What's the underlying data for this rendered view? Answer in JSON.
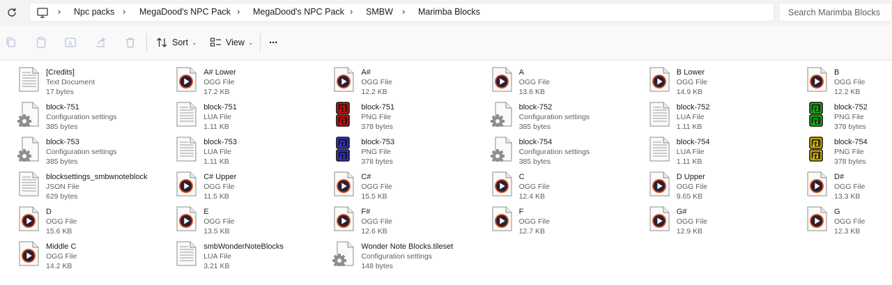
{
  "breadcrumb": [
    "Npc packs",
    "MegaDood's NPC Pack",
    "MegaDood's NPC Pack",
    "SMBW",
    "Marimba Blocks"
  ],
  "search": {
    "placeholder": "Search Marimba Blocks"
  },
  "toolbar": {
    "sort_label": "Sort",
    "view_label": "View",
    "more_label": "···"
  },
  "files": [
    {
      "name": "[Credits]",
      "type": "Text Document",
      "size": "17 bytes",
      "icon": "text-file-icon"
    },
    {
      "name": "A# Lower",
      "type": "OGG File",
      "size": "17.2 KB",
      "icon": "audio-file-icon"
    },
    {
      "name": "A#",
      "type": "OGG File",
      "size": "12.2 KB",
      "icon": "audio-file-icon"
    },
    {
      "name": "A",
      "type": "OGG File",
      "size": "13.6 KB",
      "icon": "audio-file-icon"
    },
    {
      "name": "B Lower",
      "type": "OGG File",
      "size": "14.9 KB",
      "icon": "audio-file-icon"
    },
    {
      "name": "B",
      "type": "OGG File",
      "size": "12.2 KB",
      "icon": "audio-file-icon"
    },
    {
      "name": "block-751",
      "type": "Configuration settings",
      "size": "385 bytes",
      "icon": "config-file-icon"
    },
    {
      "name": "block-751",
      "type": "LUA File",
      "size": "1.11 KB",
      "icon": "text-file-icon"
    },
    {
      "name": "block-751",
      "type": "PNG File",
      "size": "378 bytes",
      "icon": "png-thumbnail-red",
      "color": "#e01010"
    },
    {
      "name": "block-752",
      "type": "Configuration settings",
      "size": "385 bytes",
      "icon": "config-file-icon"
    },
    {
      "name": "block-752",
      "type": "LUA File",
      "size": "1.11 KB",
      "icon": "text-file-icon"
    },
    {
      "name": "block-752",
      "type": "PNG File",
      "size": "378 bytes",
      "icon": "png-thumbnail-green",
      "color": "#18c018"
    },
    {
      "name": "block-753",
      "type": "Configuration settings",
      "size": "385 bytes",
      "icon": "config-file-icon"
    },
    {
      "name": "block-753",
      "type": "LUA File",
      "size": "1.11 KB",
      "icon": "text-file-icon"
    },
    {
      "name": "block-753",
      "type": "PNG File",
      "size": "378 bytes",
      "icon": "png-thumbnail-blue",
      "color": "#3838d8"
    },
    {
      "name": "block-754",
      "type": "Configuration settings",
      "size": "385 bytes",
      "icon": "config-file-icon"
    },
    {
      "name": "block-754",
      "type": "LUA File",
      "size": "1.11 KB",
      "icon": "text-file-icon"
    },
    {
      "name": "block-754",
      "type": "PNG File",
      "size": "378 bytes",
      "icon": "png-thumbnail-yellow",
      "color": "#f0c000"
    },
    {
      "name": "blocksettings_smbwnoteblock",
      "type": "JSON File",
      "size": "629 bytes",
      "icon": "text-file-icon"
    },
    {
      "name": "C# Upper",
      "type": "OGG File",
      "size": "11.5 KB",
      "icon": "audio-file-icon"
    },
    {
      "name": "C#",
      "type": "OGG File",
      "size": "15.5 KB",
      "icon": "audio-file-icon"
    },
    {
      "name": "C",
      "type": "OGG File",
      "size": "12.4 KB",
      "icon": "audio-file-icon"
    },
    {
      "name": "D Upper",
      "type": "OGG File",
      "size": "9.65 KB",
      "icon": "audio-file-icon"
    },
    {
      "name": "D#",
      "type": "OGG File",
      "size": "13.3 KB",
      "icon": "audio-file-icon"
    },
    {
      "name": "D",
      "type": "OGG File",
      "size": "15.6 KB",
      "icon": "audio-file-icon"
    },
    {
      "name": "E",
      "type": "OGG File",
      "size": "13.5 KB",
      "icon": "audio-file-icon"
    },
    {
      "name": "F#",
      "type": "OGG File",
      "size": "12.6 KB",
      "icon": "audio-file-icon"
    },
    {
      "name": "F",
      "type": "OGG File",
      "size": "12.7 KB",
      "icon": "audio-file-icon"
    },
    {
      "name": "G#",
      "type": "OGG File",
      "size": "12.9 KB",
      "icon": "audio-file-icon"
    },
    {
      "name": "G",
      "type": "OGG File",
      "size": "12.3 KB",
      "icon": "audio-file-icon"
    },
    {
      "name": "Middle C",
      "type": "OGG File",
      "size": "14.2 KB",
      "icon": "audio-file-icon"
    },
    {
      "name": "smbWonderNoteBlocks",
      "type": "LUA File",
      "size": "3.21 KB",
      "icon": "text-file-icon"
    },
    {
      "name": "Wonder Note Blocks.tileset",
      "type": "Configuration settings",
      "size": "148 bytes",
      "icon": "config-file-icon"
    }
  ]
}
